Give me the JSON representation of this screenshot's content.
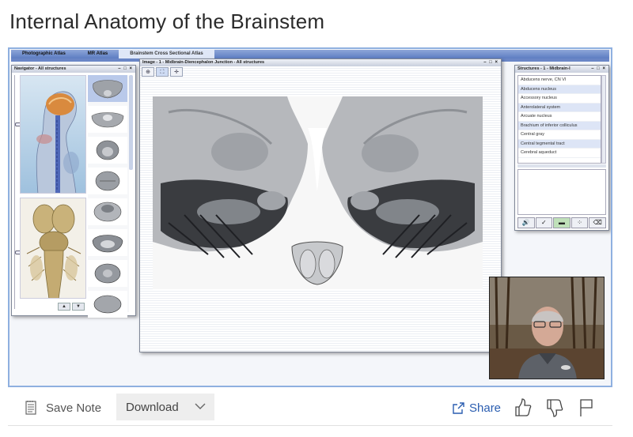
{
  "page": {
    "title": "Internal Anatomy of the Brainstem"
  },
  "atlas": {
    "tabs": [
      {
        "label": "Photographic Atlas",
        "active": false
      },
      {
        "label": "MR Atlas",
        "active": false
      },
      {
        "label": "Brainstem Cross Sectional Atlas",
        "active": true
      }
    ]
  },
  "navigator": {
    "title": "Navigator - All structures",
    "up": "▲",
    "down": "▼"
  },
  "image_window": {
    "title": "Image - 1 - Midbrain-Diencephalon Junction - All structures"
  },
  "structures": {
    "title": "Structures - 1 - Midbrain-I",
    "items": [
      "Abducens nerve, CN VI",
      "Abducens nucleus",
      "Accessory nucleus",
      "Anterolateral system",
      "Arcuate nucleus",
      "Brachium of inferior colliculus",
      "Central gray",
      "Central tegmental tract",
      "Cerebral aqueduct"
    ]
  },
  "window_controls": "– □ ×",
  "toolbar": {
    "save_note": "Save Note",
    "download": "Download",
    "share": "Share"
  },
  "colors": {
    "accent": "#2a5db0",
    "frame_border": "#8fb0e0"
  }
}
